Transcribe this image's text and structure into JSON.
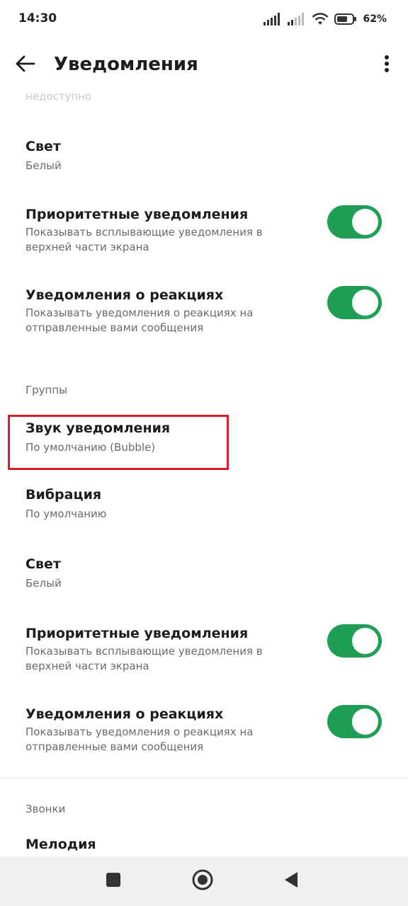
{
  "status_bar": {
    "time": "14:30",
    "battery_percent": "62%",
    "icons": [
      "signal-icon",
      "signal-weak-icon",
      "wifi-icon",
      "battery-icon"
    ]
  },
  "app_bar": {
    "title": "Уведомления",
    "back_icon": "arrow-back-icon",
    "menu_icon": "more-vert-icon"
  },
  "settings": {
    "top_partial_sub": "недоступно",
    "light_1": {
      "title": "Свет",
      "value": "Белый"
    },
    "priority_1": {
      "title": "Приоритетные уведомления",
      "description": "Показывать всплывающие уведомления в верхней части экрана",
      "enabled": true
    },
    "reactions_1": {
      "title": "Уведомления о реакциях",
      "description": "Показывать уведомления о реакциях на отправленные вами сообщения",
      "enabled": true
    },
    "groups_header": "Группы",
    "sound": {
      "title": "Звук уведомления",
      "value": "По умолчанию (Bubble)"
    },
    "vibration": {
      "title": "Вибрация",
      "value": "По умолчанию"
    },
    "light_2": {
      "title": "Свет",
      "value": "Белый"
    },
    "priority_2": {
      "title": "Приоритетные уведомления",
      "description": "Показывать всплывающие уведомления в верхней части экрана",
      "enabled": true
    },
    "reactions_2": {
      "title": "Уведомления о реакциях",
      "description": "Показывать уведомления о реакциях на отправленные вами сообщения",
      "enabled": true
    },
    "calls_header": "Звонки",
    "ringtone": {
      "title": "Мелодия"
    }
  },
  "colors": {
    "toggle_on": "#1f9e56",
    "highlight": "#d91e2a"
  },
  "nav_bar": {
    "icons": [
      "recents-square-icon",
      "home-circle-icon",
      "back-triangle-icon"
    ]
  }
}
